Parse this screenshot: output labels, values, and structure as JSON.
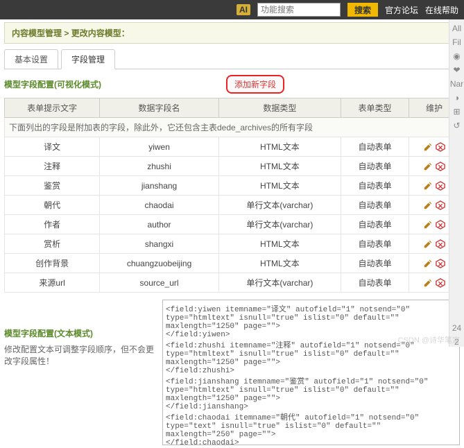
{
  "topbar": {
    "badge": "AI",
    "search_placeholder": "功能搜索",
    "search_btn": "搜索",
    "forum": "官方论坛",
    "help": "在线帮助"
  },
  "crumb": {
    "a": "内容模型管理",
    "sep": " > ",
    "b": "更改内容模型：",
    "tail": ""
  },
  "tabs": {
    "basic": "基本设置",
    "fields": "字段管理"
  },
  "section": {
    "visual": "模型字段配置(可视化模式)",
    "addbtn": "添加新字段",
    "textmode_title": "模型字段配置(文本模式)",
    "textmode_desc": "修改配置文本可调整字段顺序，但不会更改字段属性！"
  },
  "headers": {
    "label": "表单提示文字",
    "name": "数据字段名",
    "type": "数据类型",
    "form": "表单类型",
    "ops": "维护"
  },
  "note": "下面列出的字段是附加表的字段，除此外，它还包含主表dede_archives的所有字段",
  "rows": [
    {
      "label": "译文",
      "name": "yiwen",
      "type": "HTML文本",
      "form": "自动表单"
    },
    {
      "label": "注释",
      "name": "zhushi",
      "type": "HTML文本",
      "form": "自动表单"
    },
    {
      "label": "鉴赏",
      "name": "jianshang",
      "type": "HTML文本",
      "form": "自动表单"
    },
    {
      "label": "朝代",
      "name": "chaodai",
      "type": "单行文本(varchar)",
      "form": "自动表单"
    },
    {
      "label": "作者",
      "name": "author",
      "type": "单行文本(varchar)",
      "form": "自动表单"
    },
    {
      "label": "赏析",
      "name": "shangxi",
      "type": "HTML文本",
      "form": "自动表单"
    },
    {
      "label": "创作背景",
      "name": "chuangzuobeijing",
      "type": "HTML文本",
      "form": "自动表单"
    },
    {
      "label": "来源url",
      "name": "source_url",
      "type": "单行文本(varchar)",
      "form": "自动表单"
    }
  ],
  "textarea": "<field:yiwen itemname=\"译文\" autofield=\"1\" notsend=\"0\" type=\"htmltext\" isnull=\"true\" islist=\"0\" default=\"\"  maxlength=\"1250\" page=\"\">\n</field:yiwen>\n<field:zhushi itemname=\"注释\" autofield=\"1\" notsend=\"0\" type=\"htmltext\" isnull=\"true\" islist=\"0\" default=\"\"  maxlength=\"1250\" page=\"\">\n</field:zhushi>\n<field:jianshang itemname=\"鉴赏\" autofield=\"1\" notsend=\"0\" type=\"htmltext\" isnull=\"true\" islist=\"0\" default=\"\"  maxlength=\"1250\" page=\"\">\n</field:jianshang>\n<field:chaodai itemname=\"朝代\" autofield=\"1\" notsend=\"0\" type=\"text\" isnull=\"true\" islist=\"0\" default=\"\"  maxlength=\"250\" page=\"\">\n</field:chaodai>\n<field:author itemname=\"作者\" autofield=\"1\" notsend=\"0\" type=\"text\" isnull=\"true\" islist=\"0\" default=\"\"  maxlength=\"250\" page=\"\">\n</field:author>\n<field:shangxi itemname=\"赏析\" autofield=\"1\" notsend=\"0\" type=\"htmltext\" isnull=\"true\" islist=\"0\" default=\"\"  maxlength=\"1250\" page=\"\">\n</field:shangxi>\n<field:chuangzuobeijing itemname=\"创作背景\" autofield=\"1\" notsend=\"0\" type=\"htmltext\" isnull=\"",
  "watermark": "CSDN @诗华笔定",
  "side": {
    "a": "All",
    "b": "Fil",
    "c": "◉",
    "d": "❤",
    "e": "Nar",
    "f": "◑",
    "g": "⊞",
    "h": "↺",
    "i": "24",
    "j": "2"
  }
}
